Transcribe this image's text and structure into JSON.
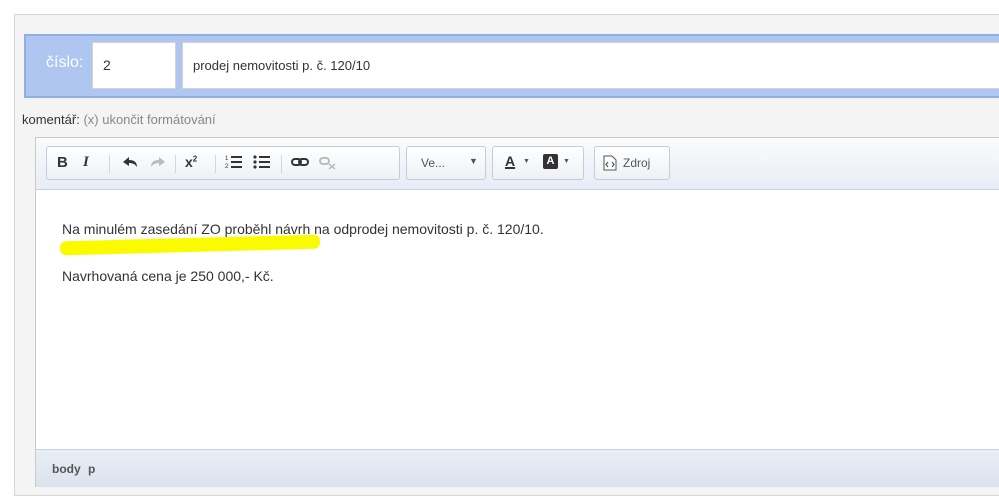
{
  "form": {
    "cislo_label": "číslo:",
    "cislo_value": "2",
    "title_value": "prodej nemovitosti p. č. 120/10"
  },
  "komentar": {
    "label": "komentář:",
    "hint": "(x) ukončit formátování"
  },
  "toolbar": {
    "bold": "B",
    "italic": "I",
    "undo": "↶",
    "redo": "↷",
    "superscript": "x²",
    "ordered_list": "≡",
    "bullet_list": "☰",
    "link": "∞",
    "unlink": "⊘",
    "format_dropdown": "Ve...",
    "text_color": "A",
    "bg_color": "A",
    "source": "Zdroj"
  },
  "content": {
    "para1": "Na minulém zasedání ZO proběhl návrh na odprodej nemovitosti p. č. 120/10.",
    "para2": "Navrhovaná cena je 250 000,- Kč."
  },
  "statusbar": {
    "path": [
      "body",
      "p"
    ]
  },
  "colors": {
    "header_bg": "#aec6f0",
    "highlight": "#fbfb00"
  },
  "icons": [
    "undo-icon",
    "redo-icon",
    "superscript-icon",
    "ordered-list-icon",
    "bullet-list-icon",
    "link-icon",
    "unlink-icon",
    "text-color-icon",
    "bg-color-icon",
    "source-icon"
  ]
}
